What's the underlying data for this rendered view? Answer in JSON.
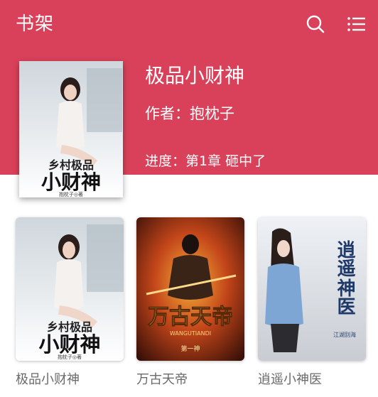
{
  "header": {
    "title": "书架",
    "search_icon": "search-icon",
    "menu_icon": "menu-icon",
    "background_color": "#d84159"
  },
  "featured": {
    "title": "极品小财神",
    "author_label": "作者：",
    "author": "抱枕子",
    "progress_label": "进度：",
    "progress_chapter": "第1章 砸中了",
    "cover": {
      "top_text": "乡村极品",
      "main_text": "小财神",
      "author_tag": "抱枕子◎著"
    }
  },
  "shelf": [
    {
      "title": "极品小财神",
      "cover": {
        "top_text": "乡村极品",
        "main_text": "小财神",
        "author_tag": "抱枕子◎著"
      }
    },
    {
      "title": "万古天帝",
      "cover": {
        "main_text": "万古天帝",
        "pinyin": "WANGUTIANDI",
        "author_tag": "第一神"
      }
    },
    {
      "title": "逍遥小神医",
      "cover": {
        "main_text_1": "逍遥",
        "main_text_2": "神医",
        "author_tag": "江湖别海"
      }
    }
  ]
}
